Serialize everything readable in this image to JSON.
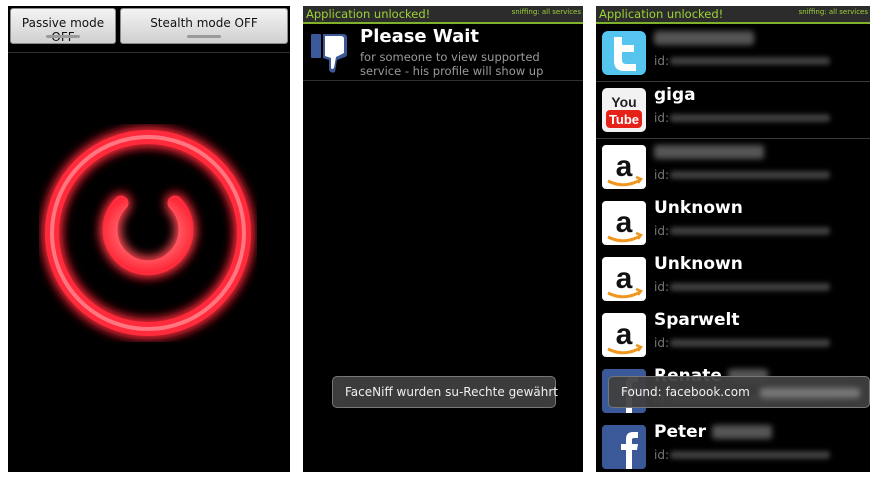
{
  "panel1": {
    "passive_button": "Passive mode OFF",
    "stealth_button": "Stealth mode OFF",
    "power_icon": "power-icon",
    "power_color": "#ff2b3a"
  },
  "panel2": {
    "status_title": "Application unlocked!",
    "status_right": "sniffing: all services",
    "wait_title": "Please Wait",
    "wait_subtitle": "for someone to view supported service - his profile will show up",
    "toast": "FaceNiff wurden su-Rechte gewährt",
    "wait_icon": "thumbs-down-icon"
  },
  "panel3": {
    "status_title": "Application unlocked!",
    "status_right": "sniffing: all services",
    "toast": "Found: facebook.com",
    "id_label": "id:",
    "rows": [
      {
        "service": "twitter",
        "name": ""
      },
      {
        "service": "youtube",
        "name": "giga"
      },
      {
        "service": "amazon",
        "name": ""
      },
      {
        "service": "amazon",
        "name": "Unknown"
      },
      {
        "service": "amazon",
        "name": "Unknown"
      },
      {
        "service": "amazon",
        "name": "Sparwelt"
      },
      {
        "service": "facebook",
        "name": "Renate"
      },
      {
        "service": "facebook",
        "name": "Peter"
      }
    ]
  },
  "colors": {
    "status_green": "#9ed337",
    "accent_line": "#7fb12a",
    "twitter_blue": "#55c4ef",
    "youtube_red": "#e62117",
    "facebook_blue": "#3b5998"
  }
}
